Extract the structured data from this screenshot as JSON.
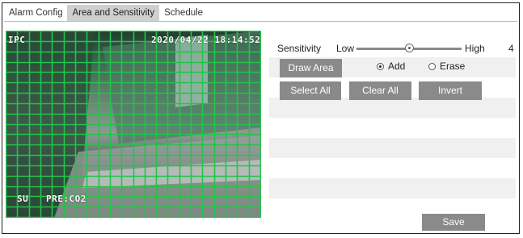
{
  "tabs": [
    {
      "label": "Alarm Config",
      "active": false
    },
    {
      "label": "Area and Sensitivity",
      "active": true
    },
    {
      "label": "Schedule",
      "active": false
    }
  ],
  "video": {
    "osd_top_left": "IPC",
    "osd_timestamp": "2020/04/22 18:14:52",
    "osd_bottom_left": "SU",
    "osd_bottom_text": "PRE:CO2",
    "grid_color": "#22c44a",
    "grid_columns": 22,
    "grid_rows": 18
  },
  "sensitivity": {
    "label": "Sensitivity",
    "low_label": "Low",
    "high_label": "High",
    "value": "4",
    "level_fraction": 0.5
  },
  "buttons": {
    "draw_area": "Draw Area",
    "select_all": "Select All",
    "clear_all": "Clear All",
    "invert": "Invert",
    "save": "Save"
  },
  "mode": {
    "add_label": "Add",
    "erase_label": "Erase",
    "selected": "add"
  },
  "colors": {
    "button_bg": "#8a8a8a",
    "active_tab_bg": "#cfcfcf",
    "row_stripe": "#f0f0f0"
  }
}
